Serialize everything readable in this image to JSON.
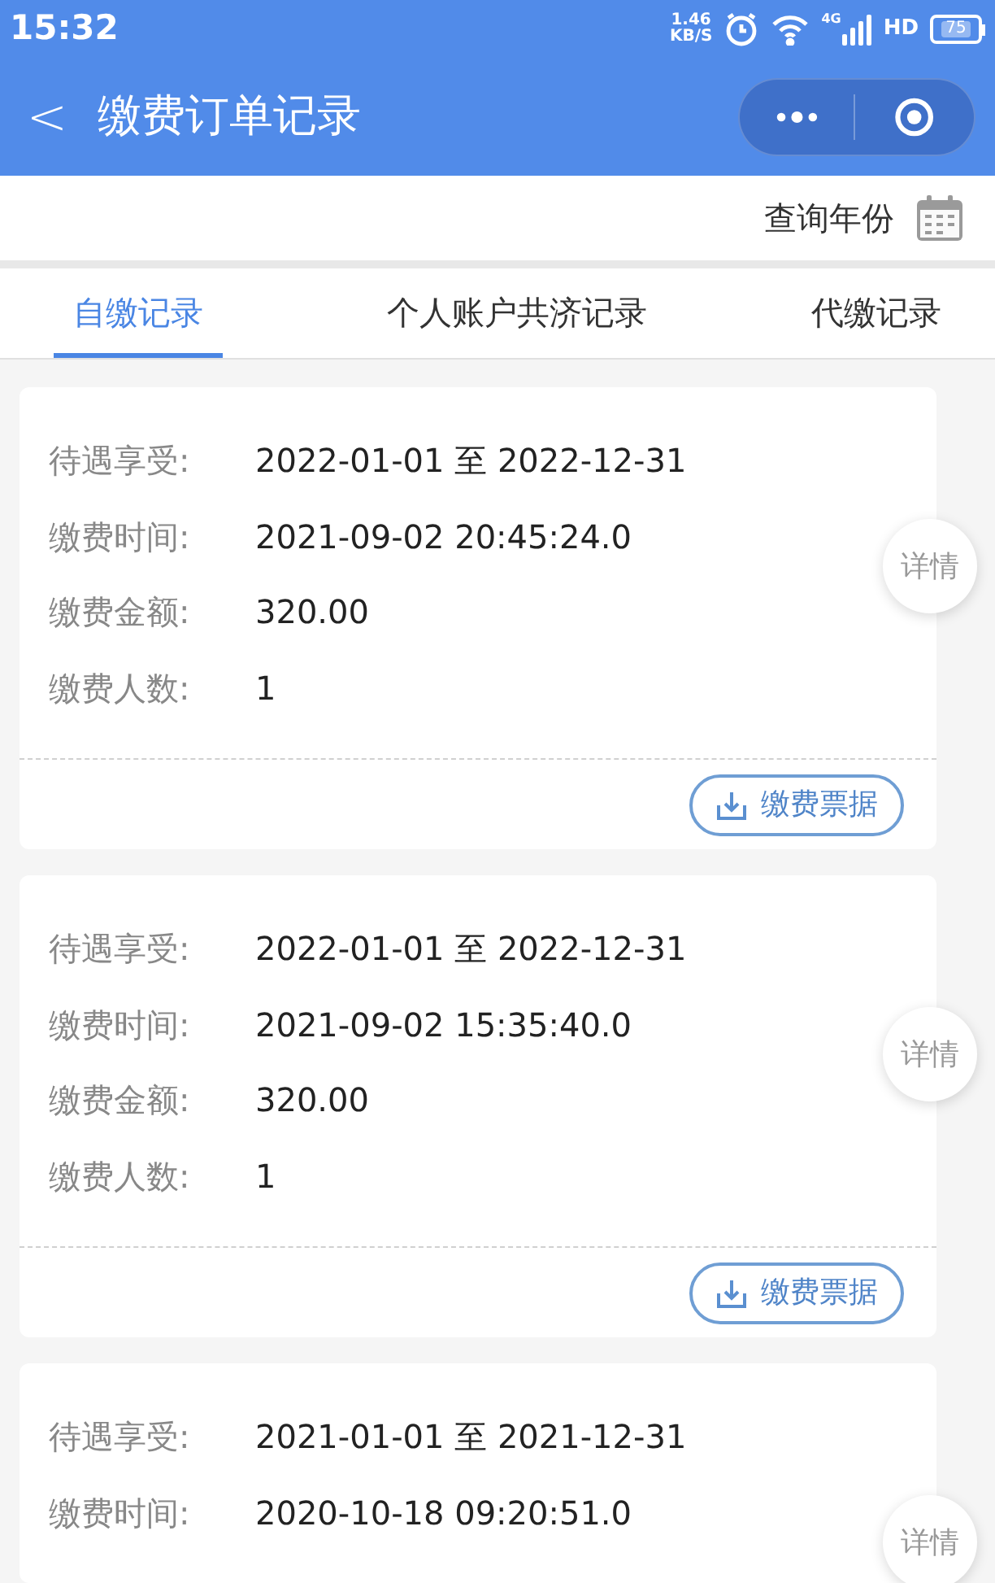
{
  "status_bar": {
    "time": "15:32",
    "net_speed": "1.46",
    "net_unit": "KB/S",
    "network": "4G",
    "hd": "HD",
    "battery": "75"
  },
  "header": {
    "back": "<",
    "title": "缴费订单记录"
  },
  "query": {
    "label": "查询年份"
  },
  "tabs": [
    {
      "label": "自缴记录",
      "selected": true
    },
    {
      "label": "个人账户共济记录",
      "selected": false
    },
    {
      "label": "代缴记录",
      "selected": false
    }
  ],
  "records": [
    {
      "fields": [
        {
          "label": "待遇享受:",
          "value": "2022-01-01 至 2022-12-31"
        },
        {
          "label": "缴费时间:",
          "value": "2021-09-02 20:45:24.0"
        },
        {
          "label": "缴费金额:",
          "value": "320.00"
        },
        {
          "label": "缴费人数:",
          "value": "1"
        }
      ],
      "detail_button": "详情",
      "receipt_button": "缴费票据"
    },
    {
      "fields": [
        {
          "label": "待遇享受:",
          "value": "2022-01-01 至 2022-12-31"
        },
        {
          "label": "缴费时间:",
          "value": "2021-09-02 15:35:40.0"
        },
        {
          "label": "缴费金额:",
          "value": "320.00"
        },
        {
          "label": "缴费人数:",
          "value": "1"
        }
      ],
      "detail_button": "详情",
      "receipt_button": "缴费票据"
    },
    {
      "fields": [
        {
          "label": "待遇享受:",
          "value": "2021-01-01 至 2021-12-31"
        },
        {
          "label": "缴费时间:",
          "value": "2020-10-18 09:20:51.0"
        }
      ],
      "detail_button": "详情"
    }
  ]
}
